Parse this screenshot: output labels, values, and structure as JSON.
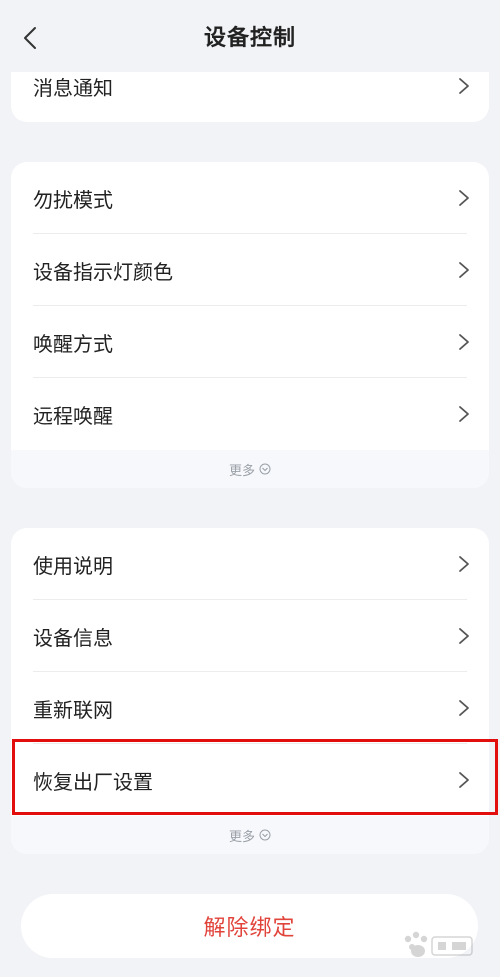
{
  "header": {
    "title": "设备控制"
  },
  "card1": {
    "items": [
      {
        "label": "消息通知"
      }
    ]
  },
  "card2": {
    "items": [
      {
        "label": "勿扰模式"
      },
      {
        "label": "设备指示灯颜色"
      },
      {
        "label": "唤醒方式"
      },
      {
        "label": "远程唤醒"
      }
    ],
    "more_label": "更多"
  },
  "card3": {
    "items": [
      {
        "label": "使用说明"
      },
      {
        "label": "设备信息"
      },
      {
        "label": "重新联网"
      },
      {
        "label": "恢复出厂设置"
      }
    ],
    "more_label": "更多"
  },
  "unbind": {
    "label": "解除绑定"
  },
  "colors": {
    "background": "#f2f3f7",
    "card": "#ffffff",
    "danger_text": "#e1443b",
    "highlight": "#e20d0d",
    "muted": "#9aa0a8"
  },
  "icons": {
    "back": "chevron-left-icon",
    "row_arrow": "chevron-right-icon",
    "more": "chevron-down-circle-icon",
    "watermark": "baidu-paw-icon"
  }
}
